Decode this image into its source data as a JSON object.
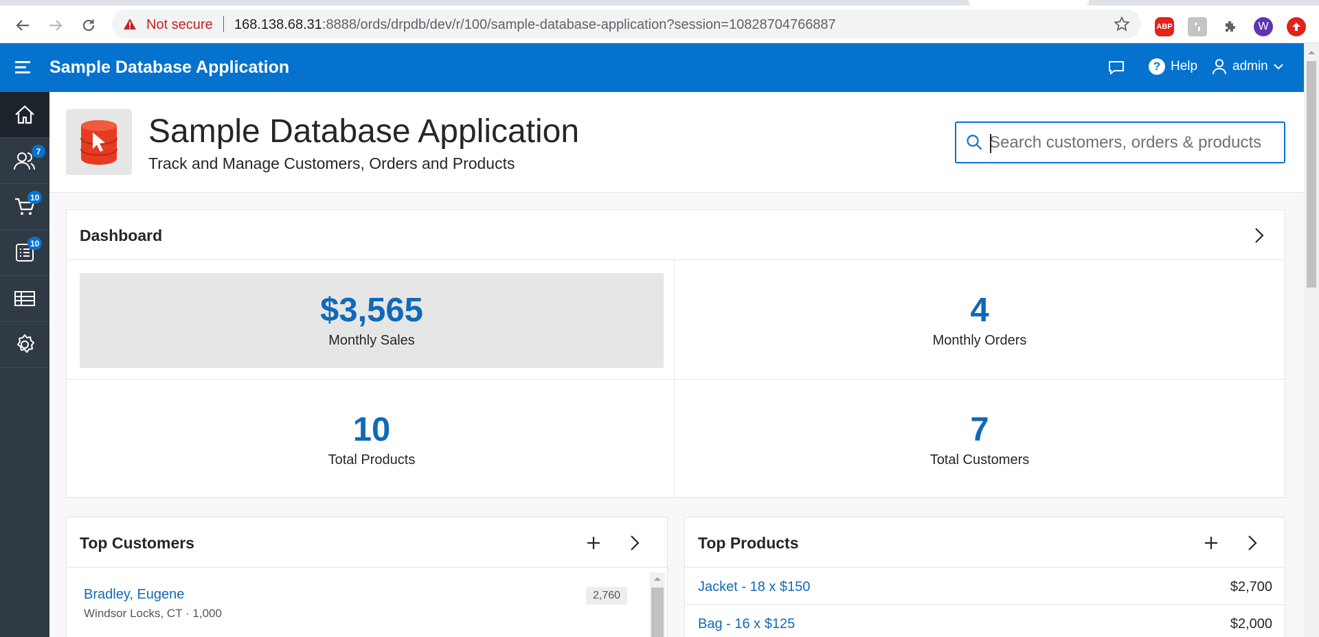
{
  "browser": {
    "not_secure": "Not secure",
    "url_host": "168.138.68.31",
    "url_rest": ":8888/ords/drpdb/dev/r/100/sample-database-application?session=10828704766887",
    "ext_abp": "ABP",
    "ext_profile": "W"
  },
  "header": {
    "app_name": "Sample Database Application",
    "help_label": "Help",
    "user_label": "admin"
  },
  "sidenav": {
    "customers_badge": "7",
    "orders_badge": "10",
    "reports_badge": "10"
  },
  "hero": {
    "title": "Sample Database Application",
    "subtitle": "Track and Manage Customers, Orders and Products",
    "search_placeholder": "Search customers, orders & products"
  },
  "dashboard": {
    "title": "Dashboard",
    "metrics": [
      {
        "value": "$3,565",
        "label": "Monthly Sales"
      },
      {
        "value": "4",
        "label": "Monthly Orders"
      },
      {
        "value": "10",
        "label": "Total Products"
      },
      {
        "value": "7",
        "label": "Total Customers"
      }
    ]
  },
  "top_customers": {
    "title": "Top Customers",
    "items": [
      {
        "name": "Bradley, Eugene",
        "detail": "Windsor Locks, CT · 1,000",
        "count": "2,760"
      }
    ]
  },
  "top_products": {
    "title": "Top Products",
    "items": [
      {
        "name": "Jacket - 18 x $150",
        "amount": "$2,700"
      },
      {
        "name": "Bag - 16 x $125",
        "amount": "$2,000"
      }
    ]
  },
  "colors": {
    "header_blue": "#0572ce",
    "nav_dark": "#2f3a45",
    "link_blue": "#0f6ab9",
    "highlight_gray": "#e6e6e6"
  }
}
